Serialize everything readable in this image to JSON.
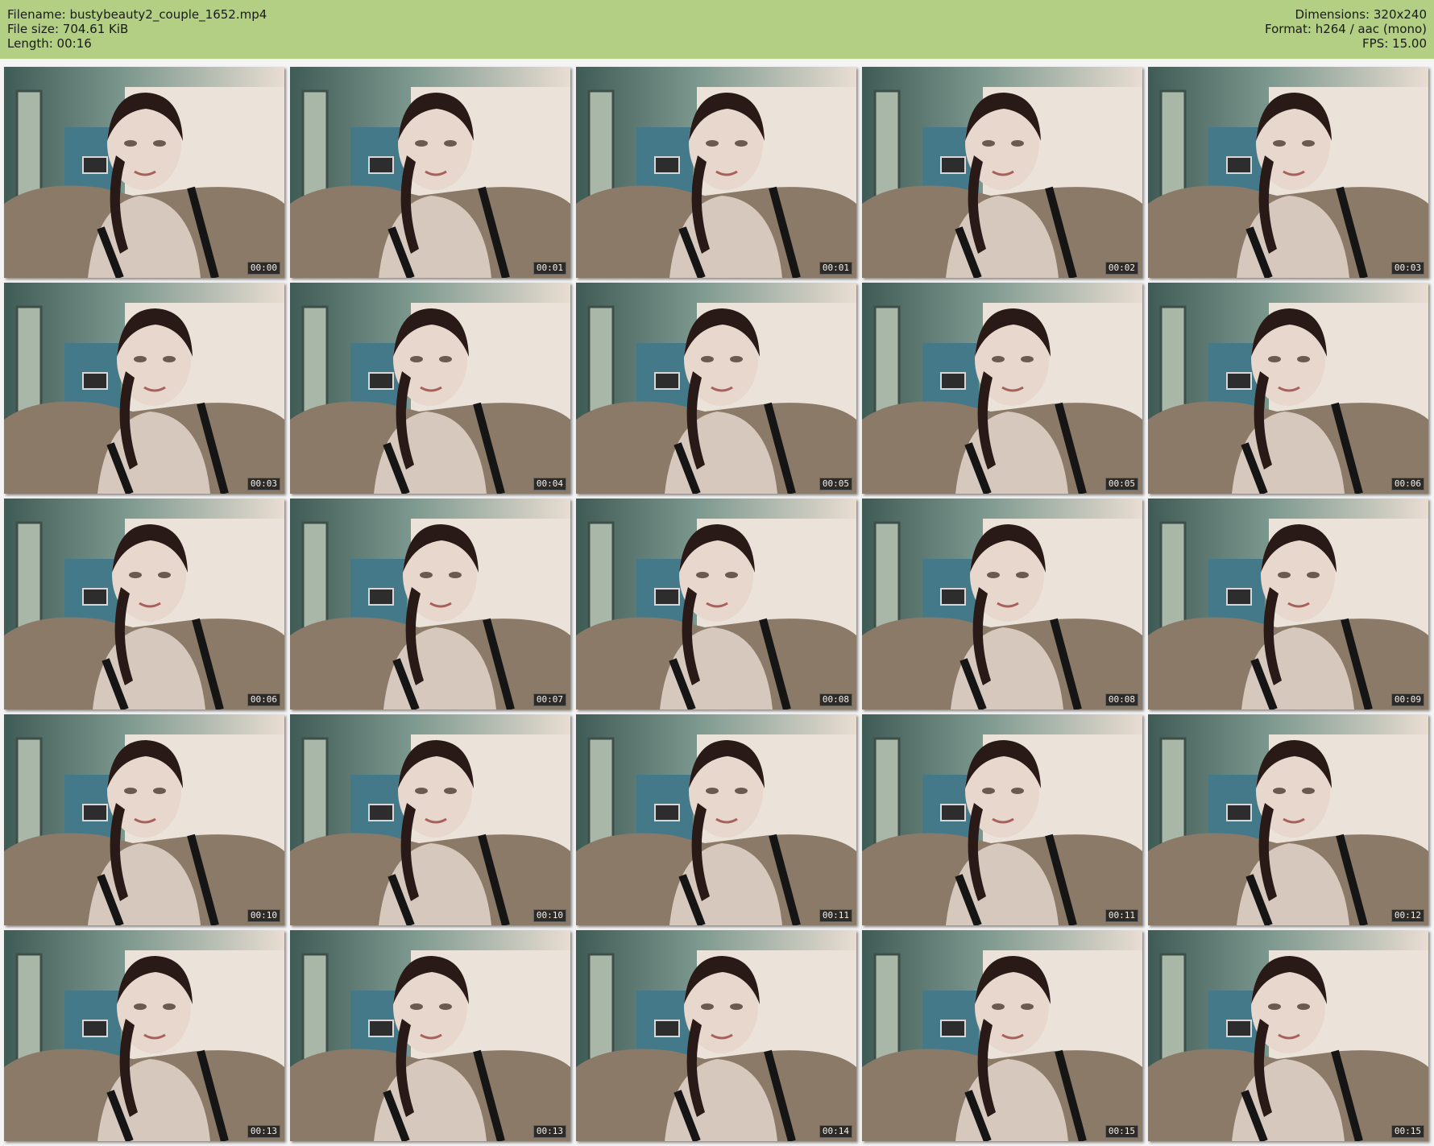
{
  "header": {
    "filename_line": "Filename: bustybeauty2_couple_1652.mp4",
    "filesize_line": "File size: 704.61 KiB",
    "length_line": "Length: 00:16",
    "dimensions_line": "Dimensions: 320x240",
    "format_line": "Format: h264 / aac (mono)",
    "fps_line": "FPS: 15.00",
    "background_color": "#b2cf84"
  },
  "thumbnails": [
    {
      "timestamp": "00:00"
    },
    {
      "timestamp": "00:01"
    },
    {
      "timestamp": "00:01"
    },
    {
      "timestamp": "00:02"
    },
    {
      "timestamp": "00:03"
    },
    {
      "timestamp": "00:03"
    },
    {
      "timestamp": "00:04"
    },
    {
      "timestamp": "00:05"
    },
    {
      "timestamp": "00:05"
    },
    {
      "timestamp": "00:06"
    },
    {
      "timestamp": "00:06"
    },
    {
      "timestamp": "00:07"
    },
    {
      "timestamp": "00:08"
    },
    {
      "timestamp": "00:08"
    },
    {
      "timestamp": "00:09"
    },
    {
      "timestamp": "00:10"
    },
    {
      "timestamp": "00:10"
    },
    {
      "timestamp": "00:11"
    },
    {
      "timestamp": "00:11"
    },
    {
      "timestamp": "00:12"
    },
    {
      "timestamp": "00:13"
    },
    {
      "timestamp": "00:13"
    },
    {
      "timestamp": "00:14"
    },
    {
      "timestamp": "00:15"
    },
    {
      "timestamp": "00:15"
    }
  ]
}
